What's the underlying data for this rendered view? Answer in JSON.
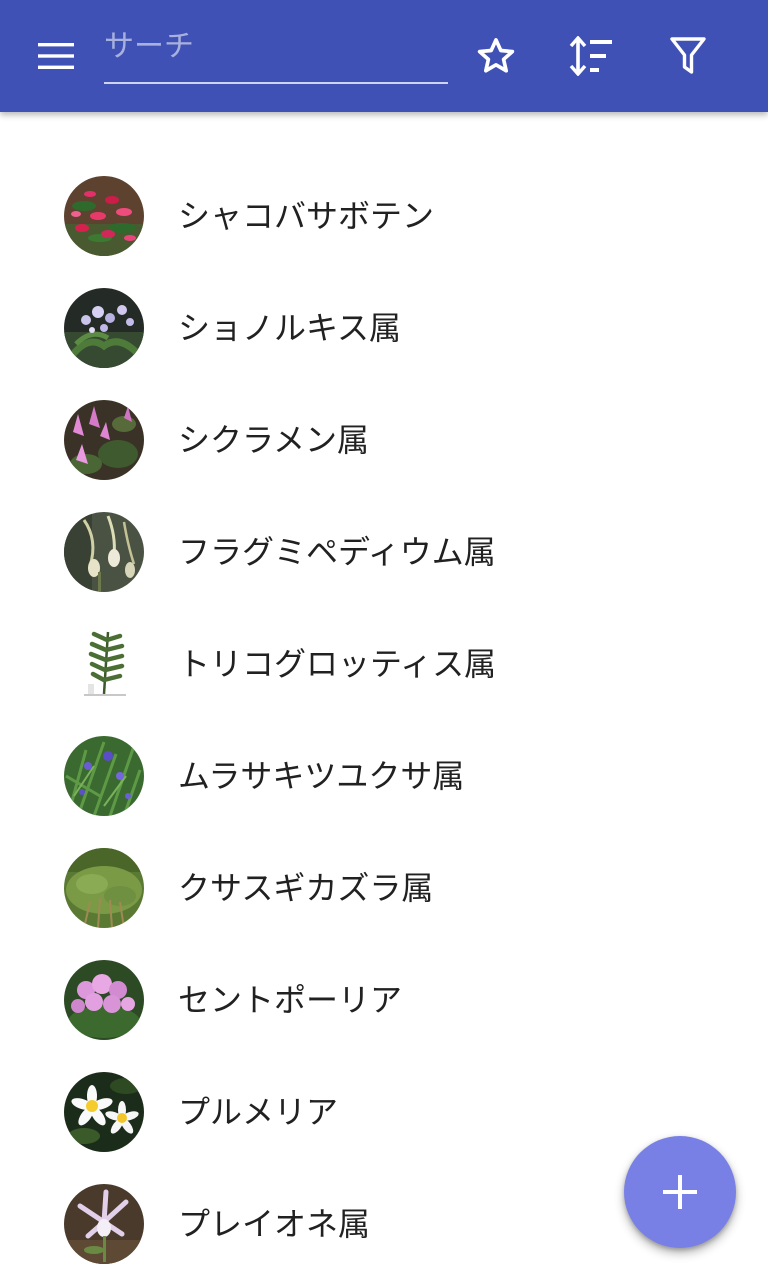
{
  "appbar": {
    "color": "#3f51b5",
    "menu_icon": "hamburger-menu-icon",
    "search": {
      "placeholder": "サーチ",
      "value": ""
    },
    "actions": [
      {
        "name": "favorites",
        "icon": "star-outline-icon"
      },
      {
        "name": "sort",
        "icon": "sort-icon"
      },
      {
        "name": "filter",
        "icon": "filter-icon"
      }
    ]
  },
  "plants": [
    {
      "label": "シャコバサボテン",
      "thumbnail": "christmas-cactus-photo"
    },
    {
      "label": "ショノルキス属",
      "thumbnail": "schoenorchis-photo"
    },
    {
      "label": "シクラメン属",
      "thumbnail": "cyclamen-photo"
    },
    {
      "label": "フラグミペディウム属",
      "thumbnail": "phragmipedium-photo"
    },
    {
      "label": "トリコグロッティス属",
      "thumbnail": "trichoglottis-photo"
    },
    {
      "label": "ムラサキツユクサ属",
      "thumbnail": "tradescantia-photo"
    },
    {
      "label": "クサスギカズラ属",
      "thumbnail": "asparagus-photo"
    },
    {
      "label": "セントポーリア",
      "thumbnail": "saintpaulia-photo"
    },
    {
      "label": "プルメリア",
      "thumbnail": "plumeria-photo"
    },
    {
      "label": "プレイオネ属",
      "thumbnail": "pleione-photo"
    }
  ],
  "fab": {
    "icon": "plus-icon",
    "color": "#7880e6"
  }
}
